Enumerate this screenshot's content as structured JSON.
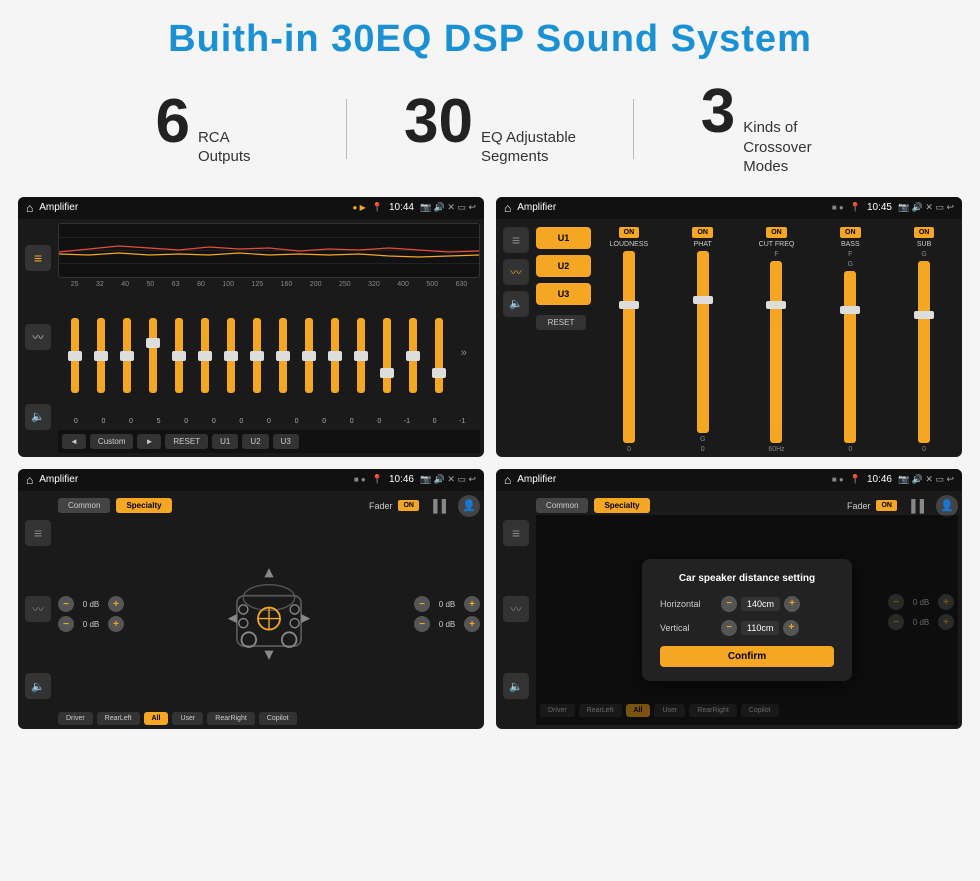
{
  "page": {
    "title": "Buith-in 30EQ DSP Sound System"
  },
  "stats": [
    {
      "number": "6",
      "label": "RCA\nOutputs"
    },
    {
      "number": "30",
      "label": "EQ Adjustable\nSegments"
    },
    {
      "number": "3",
      "label": "Kinds of\nCrossover Modes"
    }
  ],
  "screens": {
    "eq": {
      "appName": "Amplifier",
      "time": "10:44",
      "freqs": [
        "25",
        "32",
        "40",
        "50",
        "63",
        "80",
        "100",
        "125",
        "160",
        "200",
        "250",
        "320",
        "400",
        "500",
        "630"
      ],
      "values": [
        "0",
        "0",
        "0",
        "5",
        "0",
        "0",
        "0",
        "0",
        "0",
        "0",
        "0",
        "0",
        "-1",
        "0",
        "-1"
      ],
      "sliderPositions": [
        50,
        50,
        50,
        30,
        50,
        50,
        50,
        50,
        50,
        50,
        50,
        50,
        70,
        50,
        70
      ],
      "bottomBtns": [
        "◄",
        "Custom",
        "►",
        "RESET",
        "U1",
        "U2",
        "U3"
      ]
    },
    "crossover": {
      "appName": "Amplifier",
      "time": "10:45",
      "modes": [
        "U1",
        "U2",
        "U3"
      ],
      "channels": [
        {
          "name": "LOUDNESS",
          "toggle": "ON"
        },
        {
          "name": "PHAT",
          "toggle": "ON"
        },
        {
          "name": "CUT FREQ",
          "toggle": "ON"
        },
        {
          "name": "BASS",
          "toggle": "ON"
        },
        {
          "name": "SUB",
          "toggle": "ON"
        }
      ],
      "resetLabel": "RESET"
    },
    "fader": {
      "appName": "Amplifier",
      "time": "10:46",
      "tabs": [
        "Common",
        "Specialty"
      ],
      "faderLabel": "Fader",
      "faderToggle": "ON",
      "leftControls": [
        {
          "value": "0 dB"
        },
        {
          "value": "0 dB"
        }
      ],
      "rightControls": [
        {
          "value": "0 dB"
        },
        {
          "value": "0 dB"
        }
      ],
      "bottomBtns": [
        "Driver",
        "RearLeft",
        "All",
        "User",
        "RearRight",
        "Copilot"
      ]
    },
    "distance": {
      "appName": "Amplifier",
      "time": "10:46",
      "tabs": [
        "Common",
        "Specialty"
      ],
      "faderLabel": "Fader",
      "faderToggle": "ON",
      "dialog": {
        "title": "Car speaker distance setting",
        "rows": [
          {
            "label": "Horizontal",
            "value": "140cm"
          },
          {
            "label": "Vertical",
            "value": "110cm"
          }
        ],
        "confirmLabel": "Confirm"
      },
      "rightControls": [
        {
          "value": "0 dB"
        },
        {
          "value": "0 dB"
        }
      ],
      "bottomBtns": [
        "Driver",
        "RearLeft",
        "All",
        "User",
        "RearRight",
        "Copilot"
      ]
    }
  },
  "icons": {
    "home": "⌂",
    "location": "📍",
    "volume": "🔊",
    "camera": "📷",
    "eq_icon": "≡",
    "wave_icon": "〰",
    "speaker": "🔈",
    "back": "↩",
    "settings": "⚙",
    "person": "👤",
    "minus": "−",
    "plus": "+"
  },
  "colors": {
    "accent": "#f5a623",
    "title_blue": "#1a90d5",
    "bg_dark": "#1a1a1a",
    "text_light": "#ffffff",
    "text_muted": "#888888"
  }
}
